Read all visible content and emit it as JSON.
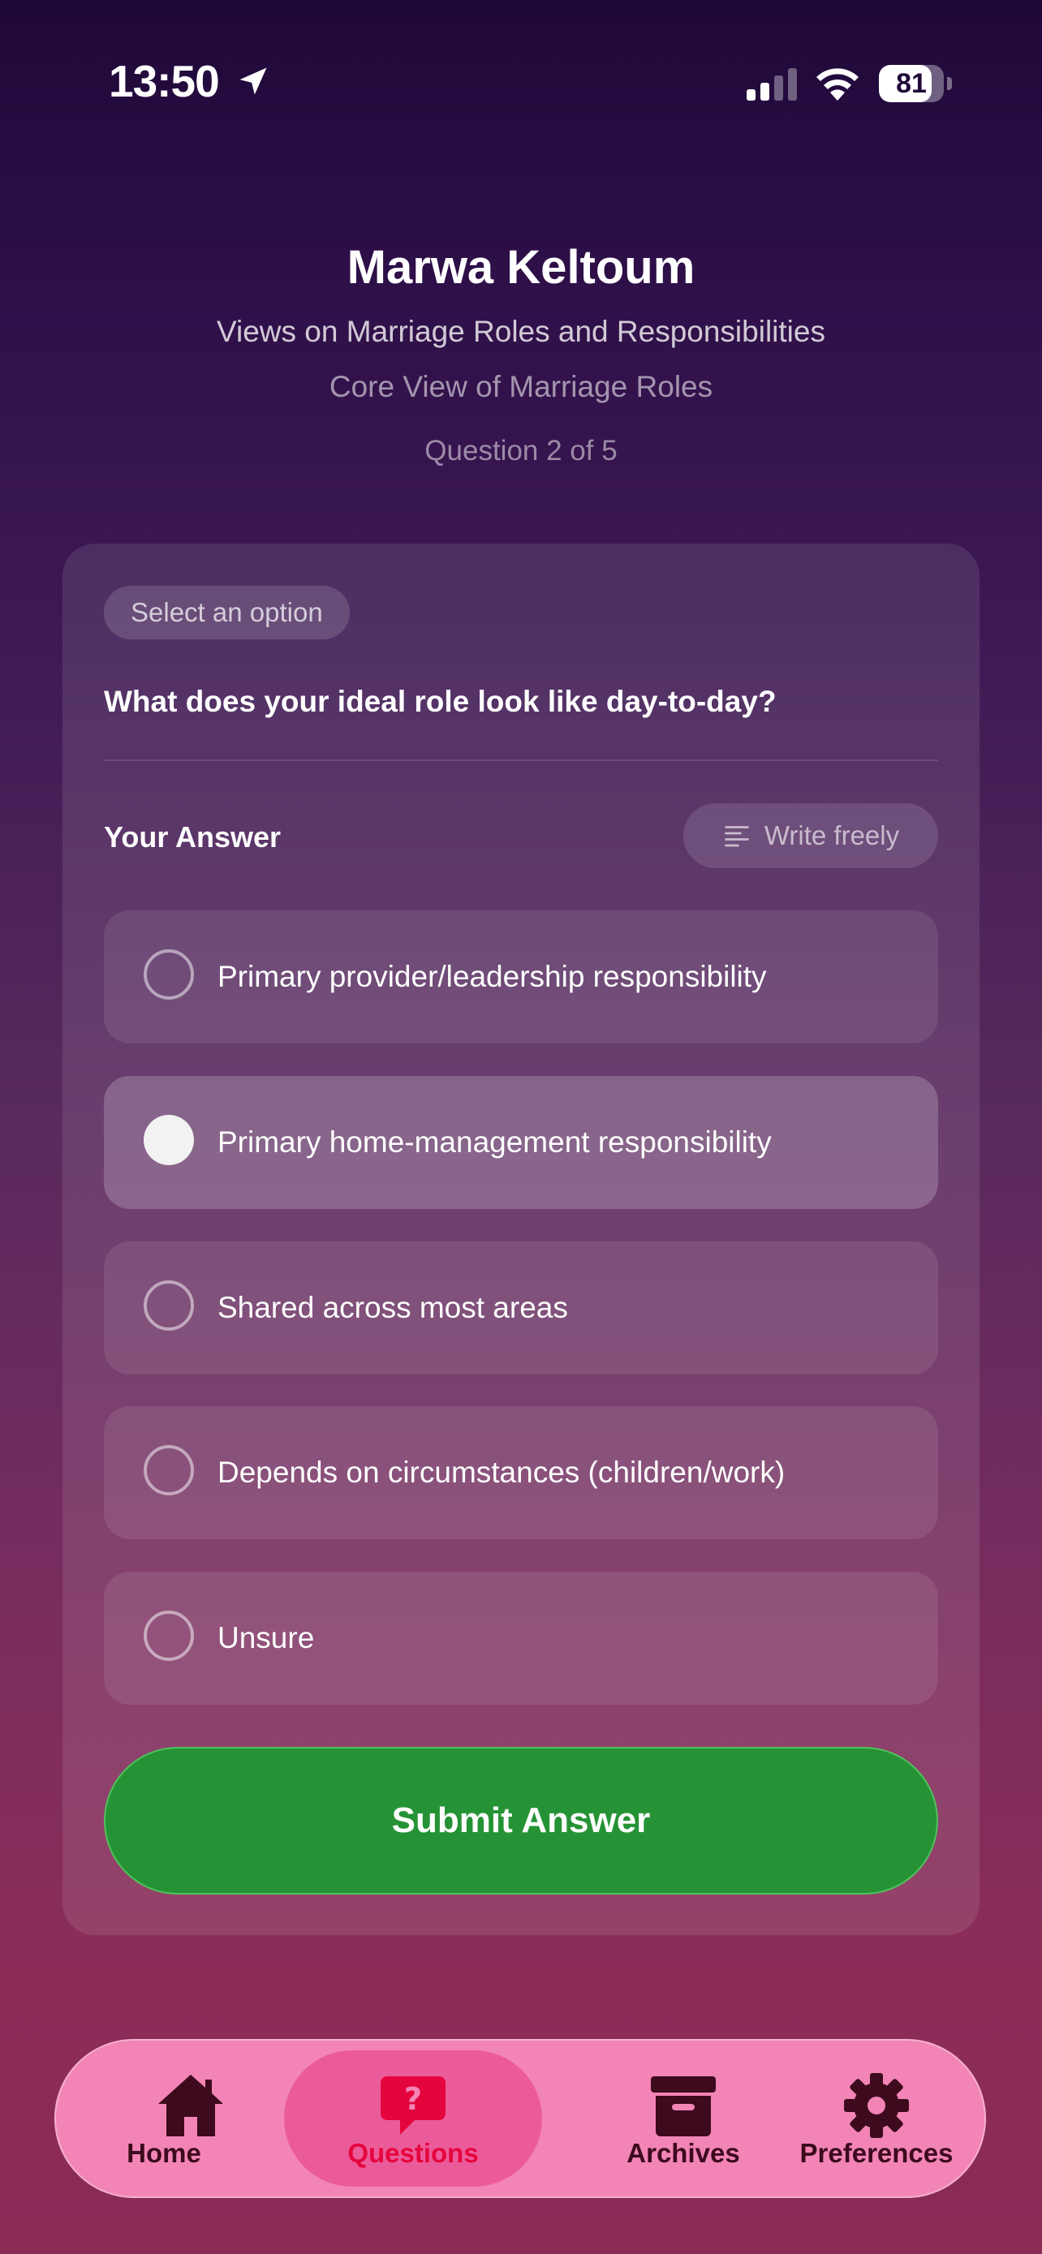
{
  "status_bar": {
    "time": "13:50",
    "battery": "81",
    "battery_level": 0.81
  },
  "header": {
    "name": "Marwa Keltoum",
    "topic": "Views on Marriage Roles and Responsibilities",
    "section": "Core View of Marriage Roles",
    "progress": "Question 2 of 5"
  },
  "question": {
    "type_chip": "Select an option",
    "text": "What does your ideal role look like day-to-day?",
    "answer_label": "Your Answer",
    "write_freely_label": "Write freely",
    "options": [
      {
        "label": "Primary provider/leadership responsibility",
        "selected": false
      },
      {
        "label": "Primary home-management responsibility",
        "selected": true
      },
      {
        "label": "Shared across most areas",
        "selected": false
      },
      {
        "label": "Depends on circumstances (children/work)",
        "selected": false
      },
      {
        "label": "Unsure",
        "selected": false
      }
    ],
    "submit_label": "Submit Answer"
  },
  "tab_bar": {
    "items": [
      {
        "label": "Home",
        "icon": "home-icon",
        "active": false
      },
      {
        "label": "Questions",
        "icon": "question-bubble-icon",
        "active": true
      },
      {
        "label": "Archives",
        "icon": "archive-box-icon",
        "active": false
      },
      {
        "label": "Preferences",
        "icon": "gear-icon",
        "active": false
      }
    ]
  },
  "colors": {
    "submit_green": "#259335",
    "tab_bar_pink": "#f285b5",
    "active_tab_red": "#e5053e",
    "icon_dark": "#3d0a1e"
  }
}
